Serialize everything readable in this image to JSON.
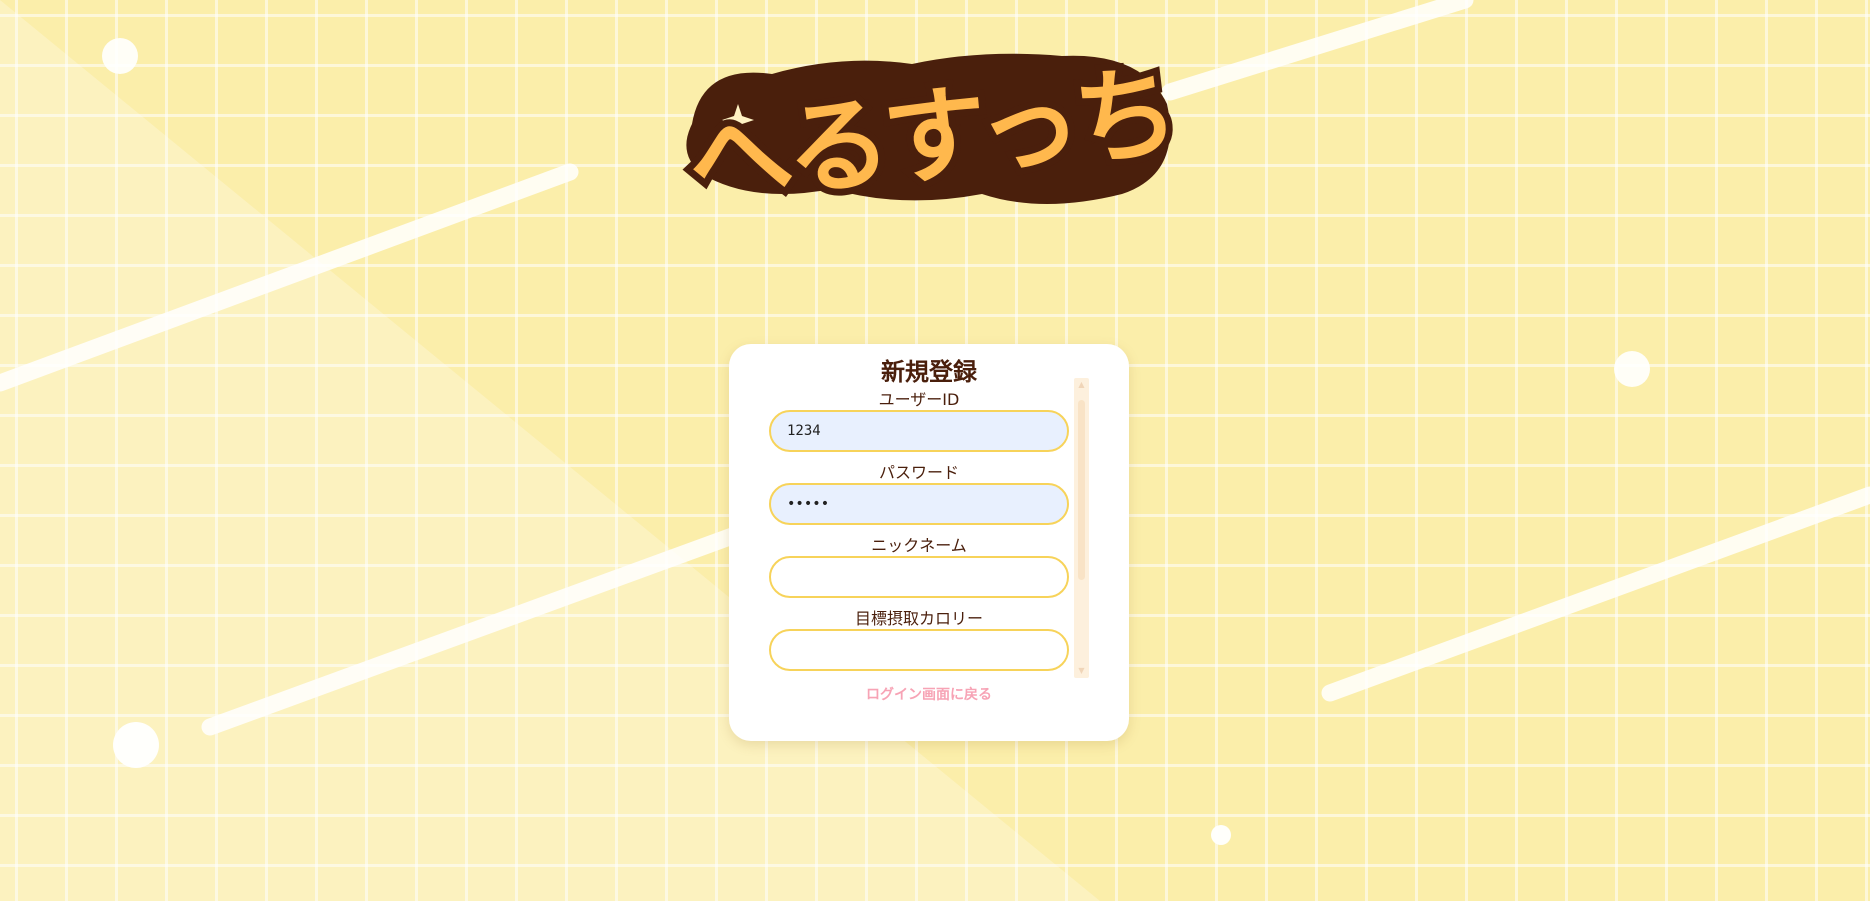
{
  "brand": {
    "logo_text": "へるすっち"
  },
  "colors": {
    "background": "#fbeeaa",
    "logo_fill": "#ffb84d",
    "logo_outline": "#4a1f0c",
    "input_border": "#f7d35a",
    "link": "#f7a3b5"
  },
  "register_form": {
    "title": "新規登録",
    "fields": [
      {
        "label": "ユーザーID",
        "value": "1234",
        "placeholder": "",
        "type": "text"
      },
      {
        "label": "パスワード",
        "value": "•••••",
        "placeholder": "",
        "type": "password"
      },
      {
        "label": "ニックネーム",
        "value": "",
        "placeholder": "",
        "type": "text"
      },
      {
        "label": "目標摂取カロリー",
        "value": "",
        "placeholder": "",
        "type": "text"
      }
    ],
    "back_link": "ログイン画面に戻る"
  },
  "icons": {
    "scroll_up": "scroll-up-arrow-icon",
    "scroll_down": "scroll-down-arrow-icon",
    "sparkle": "sparkle-icon"
  }
}
